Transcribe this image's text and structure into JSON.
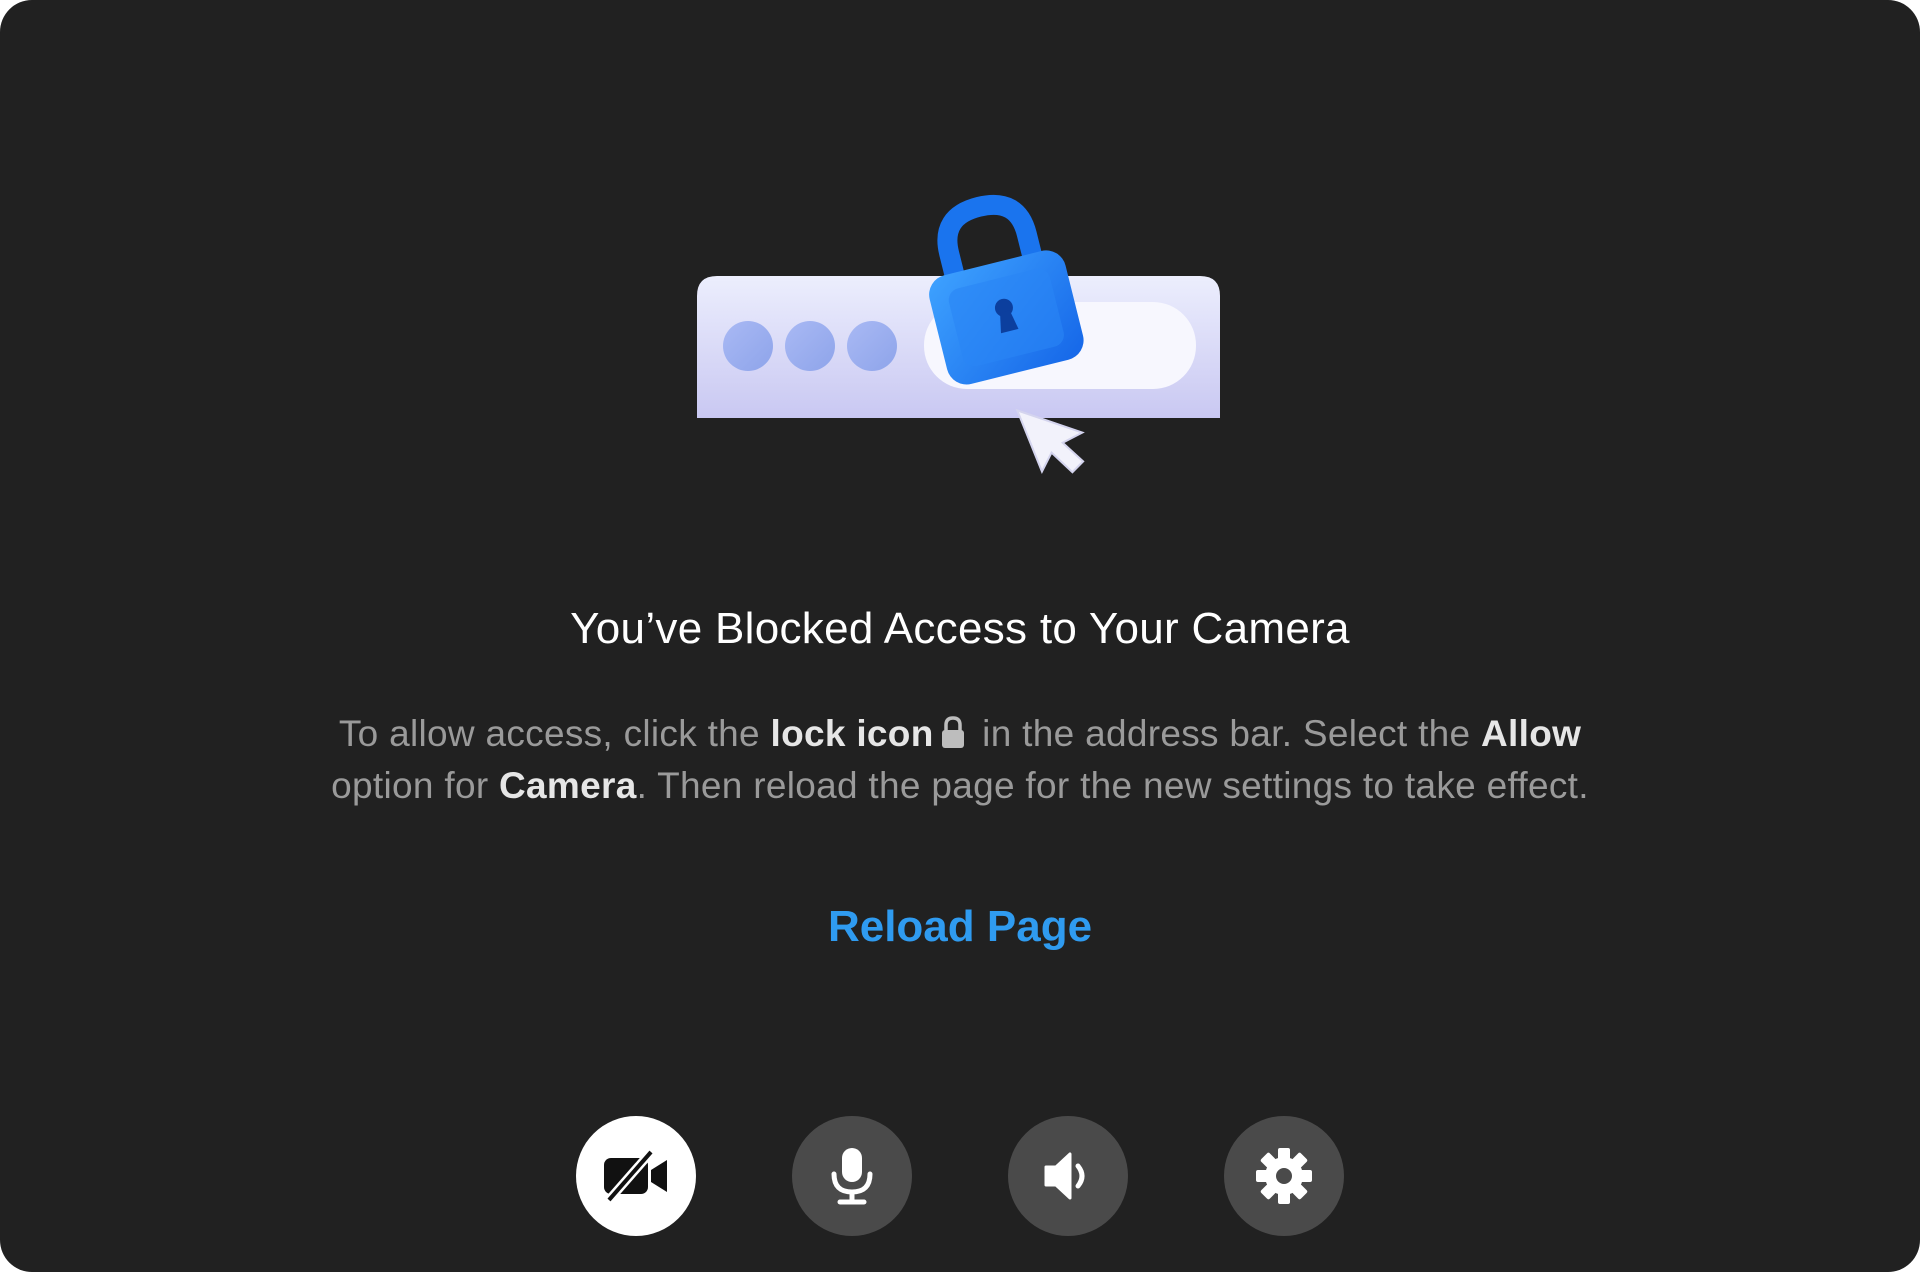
{
  "colors": {
    "background": "#212121",
    "accent": "#2f9bf0",
    "camera_button_bg": "#ffffff",
    "control_bg": "#4a4a4a",
    "lock_blue": "#1f7cf0"
  },
  "illustration": {
    "icons": [
      "browser-address-bar",
      "lock-icon",
      "cursor-arrow-icon"
    ]
  },
  "dialog": {
    "title": "You’ve Blocked Access to Your Camera",
    "desc_part1": "To allow access, click the ",
    "desc_bold1": "lock icon",
    "desc_part2": " in the address bar. Select the ",
    "desc_bold2": "Allow",
    "desc_part3": " option for ",
    "desc_bold3": "Camera",
    "desc_part4": ". Then reload the page for the new settings to take effect.",
    "reload_label": "Reload Page"
  },
  "controls": [
    {
      "name": "camera-off-button",
      "icon": "video-off-icon",
      "active": true
    },
    {
      "name": "microphone-button",
      "icon": "microphone-icon",
      "active": false
    },
    {
      "name": "speaker-button",
      "icon": "speaker-icon",
      "active": false
    },
    {
      "name": "settings-button",
      "icon": "gear-icon",
      "active": false
    }
  ]
}
